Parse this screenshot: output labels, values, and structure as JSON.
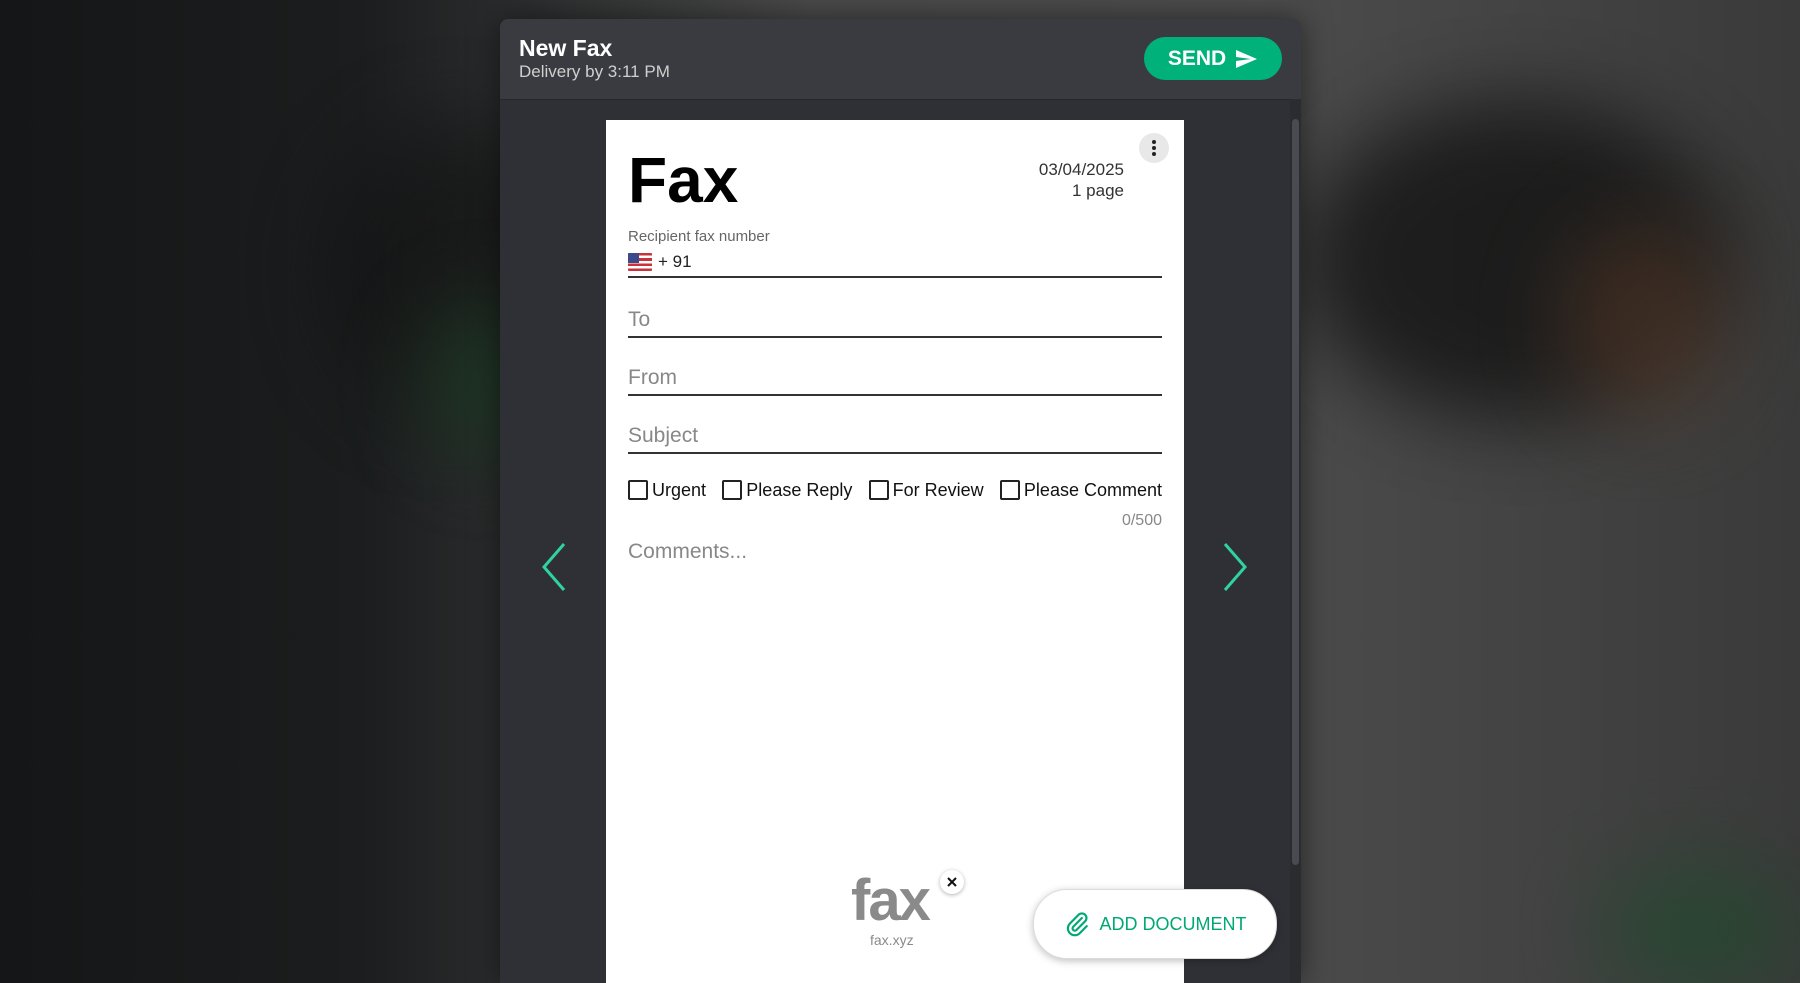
{
  "header": {
    "title": "New Fax",
    "delivery": "Delivery by 3:11 PM",
    "send_label": "SEND"
  },
  "fax": {
    "title": "Fax",
    "date": "03/04/2025",
    "pages": "1 page"
  },
  "recipient": {
    "label": "Recipient fax number",
    "country_code": "+ 91",
    "value": ""
  },
  "fields": {
    "to_placeholder": "To",
    "from_placeholder": "From",
    "subject_placeholder": "Subject",
    "to_value": "",
    "from_value": "",
    "subject_value": ""
  },
  "checkboxes": [
    {
      "label": "Urgent",
      "checked": false
    },
    {
      "label": "Please Reply",
      "checked": false
    },
    {
      "label": "For Review",
      "checked": false
    },
    {
      "label": "Please Comment",
      "checked": false
    }
  ],
  "comments": {
    "placeholder": "Comments...",
    "count": "0/500",
    "value": ""
  },
  "logo": {
    "text": "fax",
    "sub": "fax.xyz"
  },
  "add_document": {
    "label": "ADD DOCUMENT"
  },
  "colors": {
    "accent": "#00b27a",
    "arrow": "#2fd3a0"
  },
  "icons": [
    "send-icon",
    "more-vert-icon",
    "flag-us-icon",
    "chevron-left-icon",
    "chevron-right-icon",
    "close-icon",
    "paperclip-icon"
  ]
}
